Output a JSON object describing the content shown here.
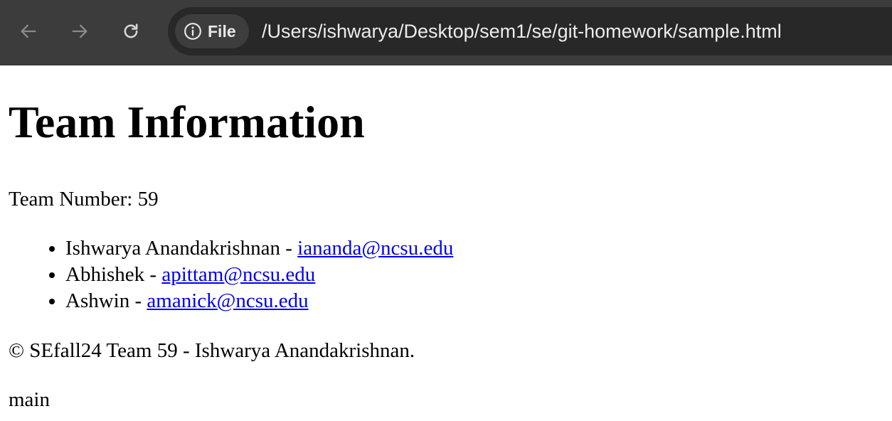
{
  "browser": {
    "site_chip_label": "File",
    "url": "/Users/ishwarya/Desktop/sem1/se/git-homework/sample.html",
    "icons": {
      "back": "arrow-left-icon",
      "forward": "arrow-right-icon",
      "reload": "reload-icon",
      "site_info": "info-icon"
    },
    "colors": {
      "toolbar": "#3c3c3c",
      "omnibox": "#282828",
      "chip": "#3d3d3d",
      "link": "#0000ee"
    }
  },
  "page": {
    "heading": "Team Information",
    "team_number": "Team Number: 59",
    "members": [
      {
        "name": "Ishwarya Anandakrishnan - ",
        "email": "iananda@ncsu.edu"
      },
      {
        "name": "Abhishek - ",
        "email": "apittam@ncsu.edu"
      },
      {
        "name": "Ashwin - ",
        "email": "amanick@ncsu.edu"
      }
    ],
    "footer": "© SEfall24 Team 59 - Ishwarya Anandakrishnan.",
    "branch": "main"
  }
}
